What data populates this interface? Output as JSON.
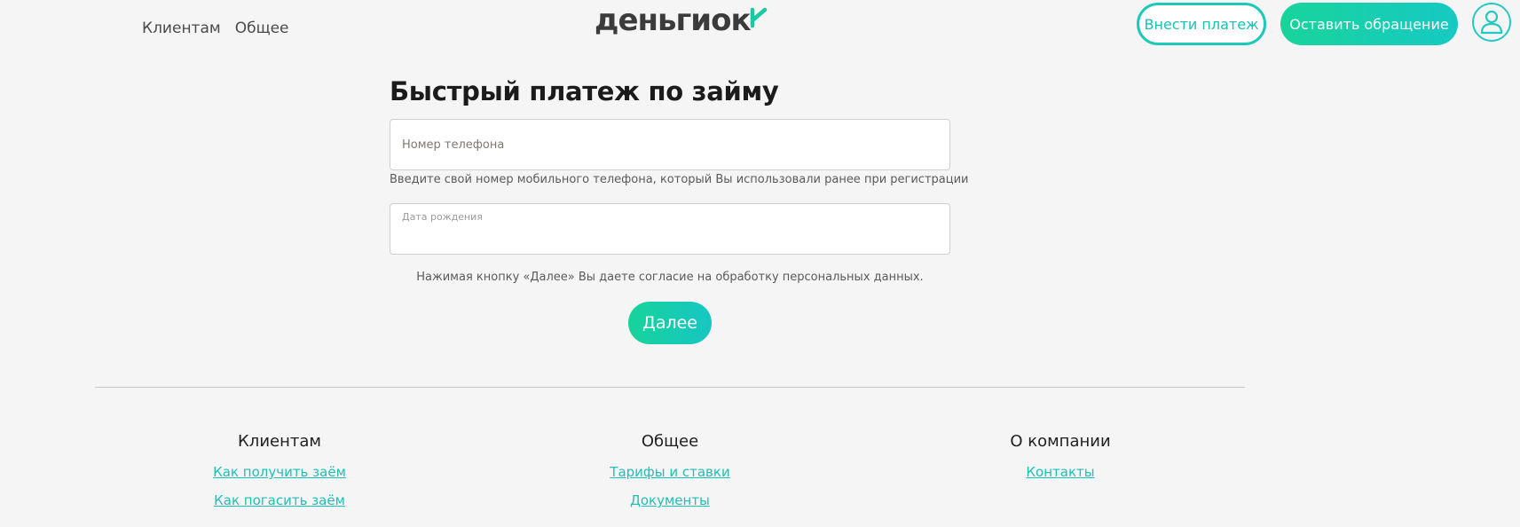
{
  "header": {
    "nav": [
      "Клиентам",
      "Общее"
    ],
    "logo_text": "деньгиок",
    "pay_button": "Внести платеж",
    "contact_button": "Оставить обращение",
    "user_icon": "user-icon"
  },
  "form": {
    "title": "Быстрый платеж по займу",
    "phone_placeholder": "Номер телефона",
    "phone_hint": "Введите свой номер мобильного телефона, который Вы использовали ранее при регистрации",
    "dob_label": "Дата рождения",
    "consent_text": "Нажимая кнопку «Далее» Вы даете согласие на обработку персональных данных.",
    "next_button": "Далее"
  },
  "footer": {
    "columns": [
      {
        "title": "Клиентам",
        "links": [
          "Как получить заём",
          "Как погасить заём"
        ]
      },
      {
        "title": "Общее",
        "links": [
          "Тарифы и ставки",
          "Документы"
        ]
      },
      {
        "title": "О компании",
        "links": [
          "Контакты"
        ]
      }
    ]
  },
  "colors": {
    "accent": "#1cc9b8",
    "gradient_start": "#18d49a",
    "gradient_end": "#17c9c4",
    "background": "#f5f5f5"
  }
}
